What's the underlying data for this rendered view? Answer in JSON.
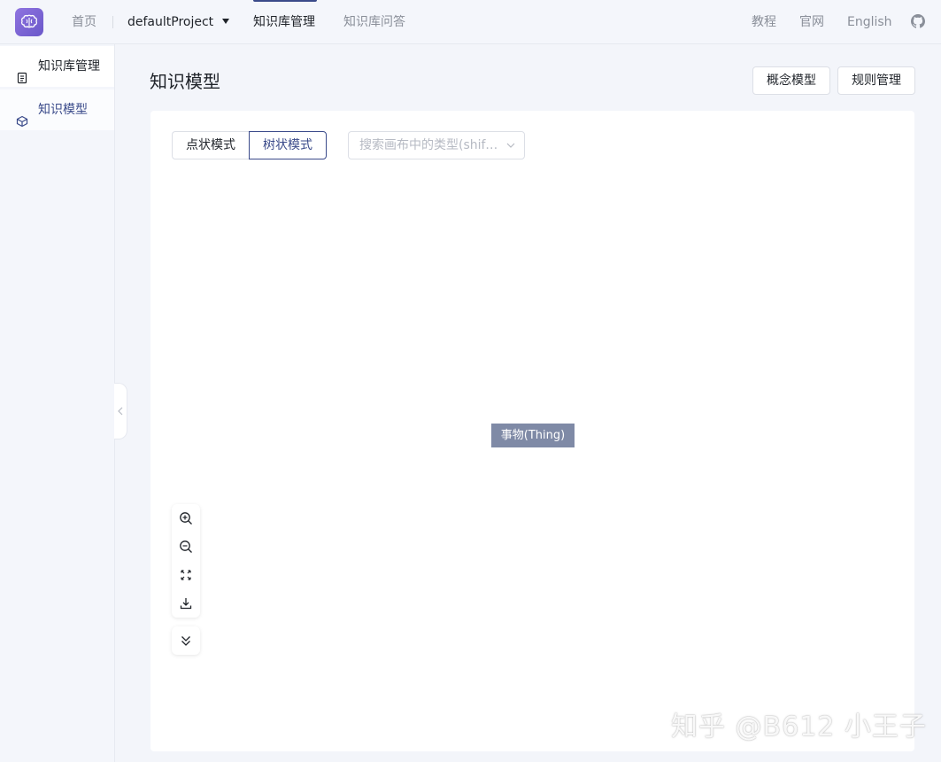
{
  "topbar": {
    "home": "首页",
    "project": "defaultProject",
    "kb_manage": "知识库管理",
    "kb_qa": "知识库问答",
    "tutorial": "教程",
    "official_site": "官网",
    "language": "English"
  },
  "sidebar": {
    "items": [
      {
        "label": "知识库管理",
        "icon": "document-icon"
      },
      {
        "label": "知识模型",
        "icon": "cube-icon",
        "active": true
      }
    ]
  },
  "main": {
    "title": "知识模型",
    "buttons": {
      "concept_model": "概念模型",
      "rule_manage": "规则管理"
    },
    "view_modes": {
      "dot": "点状模式",
      "tree": "树状模式",
      "selected": "树状模式"
    },
    "search": {
      "placeholder": "搜索画布中的类型(shift+"
    },
    "graph": {
      "root_node": "事物(Thing)"
    }
  },
  "watermark": "知乎 @B612 小王子",
  "colors": {
    "accent": "#3a4a8a",
    "node": "#7f8aa6",
    "logo": "#7a63d4"
  }
}
